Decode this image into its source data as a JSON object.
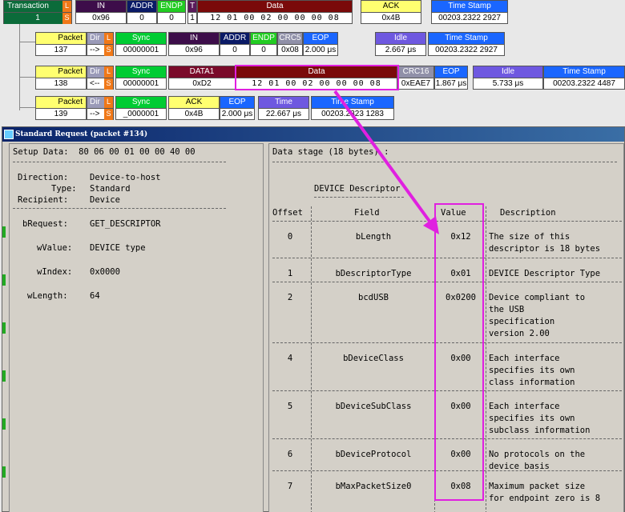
{
  "trace": {
    "transaction": {
      "label": "Transaction",
      "value": "1",
      "L": "L",
      "S": "S",
      "in": {
        "h": "IN",
        "v": "0x96"
      },
      "addr": {
        "h": "ADDR",
        "v": "0"
      },
      "endp": {
        "h": "ENDP",
        "v": "0"
      },
      "t": {
        "h": "T",
        "v": "1"
      },
      "data": {
        "h": "Data",
        "v": "12 01 00 02 00 00 00 08"
      },
      "ack": {
        "h": "ACK",
        "v": "0x4B"
      },
      "ts": {
        "h": "Time Stamp",
        "v": "00203.2322 2927"
      }
    },
    "packet137": {
      "packet": {
        "h": "Packet",
        "v": "137"
      },
      "dir": {
        "h": "Dir",
        "v": "-->"
      },
      "L": "L",
      "S": "S",
      "sync": {
        "h": "Sync",
        "v": "00000001"
      },
      "in": {
        "h": "IN",
        "v": "0x96"
      },
      "addr": {
        "h": "ADDR",
        "v": "0"
      },
      "endp": {
        "h": "ENDP",
        "v": "0"
      },
      "crc5": {
        "h": "CRC5",
        "v": "0x08"
      },
      "eop": {
        "h": "EOP",
        "v": "2.000 μs"
      },
      "idle": {
        "h": "Idle",
        "v": "2.667 μs"
      },
      "ts": {
        "h": "Time Stamp",
        "v": "00203.2322 2927"
      }
    },
    "packet138": {
      "packet": {
        "h": "Packet",
        "v": "138"
      },
      "dir": {
        "h": "Dir",
        "v": "<--"
      },
      "L": "L",
      "S": "S",
      "sync": {
        "h": "Sync",
        "v": "00000001"
      },
      "data1": {
        "h": "DATA1",
        "v": "0xD2"
      },
      "data": {
        "h": "Data",
        "v": "12 01 00 02 00 00 00 08"
      },
      "crc16": {
        "h": "CRC16",
        "v": "0xEAE7"
      },
      "eop": {
        "h": "EOP",
        "v": "1.867 μs"
      },
      "idle": {
        "h": "Idle",
        "v": "5.733 μs"
      },
      "ts": {
        "h": "Time Stamp",
        "v": "00203.2322 4487"
      }
    },
    "packet139": {
      "packet": {
        "h": "Packet",
        "v": "139"
      },
      "dir": {
        "h": "Dir",
        "v": "-->"
      },
      "L": "L",
      "S": "S",
      "sync": {
        "h": "Sync",
        "v": "_0000001"
      },
      "ack": {
        "h": "ACK",
        "v": "0x4B"
      },
      "eop": {
        "h": "EOP",
        "v": "2.000 μs"
      },
      "time": {
        "h": "Time",
        "v": "22.667 μs"
      },
      "ts": {
        "h": "Time Stamp",
        "v": "00203.2323 1283"
      }
    }
  },
  "window": {
    "title": "Standard Request (packet #134)"
  },
  "left": {
    "setup": "Setup Data:  80 06 00 01 00 00 40 00",
    "sep": "------------------------------------",
    "direction_k": "Direction:",
    "direction_v": "Device-to-host",
    "type_k": "Type:",
    "type_v": "Standard",
    "recipient_k": "Recipient:",
    "recipient_v": "Device",
    "breq_k": "bRequest:",
    "breq_v": "GET_DESCRIPTOR",
    "wvalue_k": "wValue:",
    "wvalue_v": "DEVICE type",
    "windex_k": "wIndex:",
    "windex_v": "0x0000",
    "wlength_k": "wLength:",
    "wlength_v": "64"
  },
  "right": {
    "header": "Data stage (18 bytes) :",
    "desc_title": "DEVICE Descriptor",
    "cols": {
      "offset": "Offset",
      "field": "Field",
      "value": "Value",
      "desc": "Description"
    },
    "rows": [
      {
        "o": "0",
        "f": "bLength",
        "v": "0x12",
        "d": [
          "The size of this",
          "descriptor is 18 bytes"
        ]
      },
      {
        "o": "1",
        "f": "bDescriptorType",
        "v": "0x01",
        "d": [
          "DEVICE Descriptor Type"
        ]
      },
      {
        "o": "2",
        "f": "bcdUSB",
        "v": "0x0200",
        "d": [
          "Device compliant to",
          "the USB",
          "specification",
          "version 2.00"
        ]
      },
      {
        "o": "4",
        "f": "bDeviceClass",
        "v": "0x00",
        "d": [
          "Each interface",
          "specifies its own",
          "class information"
        ]
      },
      {
        "o": "5",
        "f": "bDeviceSubClass",
        "v": "0x00",
        "d": [
          "Each interface",
          "specifies its own",
          "subclass information"
        ]
      },
      {
        "o": "6",
        "f": "bDeviceProtocol",
        "v": "0x00",
        "d": [
          "No protocols on the",
          "device basis"
        ]
      },
      {
        "o": "7",
        "f": "bMaxPacketSize0",
        "v": "0x08",
        "d": [
          "Maximum packet size",
          "for endpoint zero is 8"
        ]
      }
    ]
  },
  "colors": {
    "highlight": "#e020e0"
  }
}
